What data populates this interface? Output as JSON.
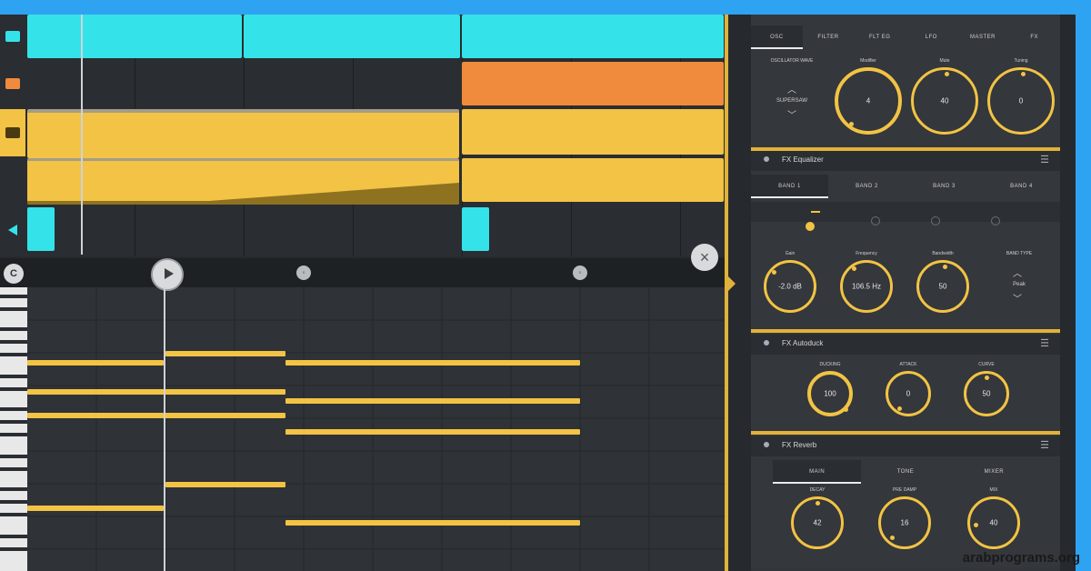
{
  "colors": {
    "accent": "#f2c344",
    "cyan": "#34e3ea",
    "orange": "#f08a3c",
    "background": "#26292d",
    "frame": "#2ea3f2"
  },
  "tracks": [
    {
      "icon": "synth-track-icon",
      "color": "#34e3ea"
    },
    {
      "icon": "bass-track-icon",
      "color": "#f08a3c"
    },
    {
      "icon": "keys-track-icon",
      "color": "#f2c344"
    },
    {
      "icon": "automation-track-icon",
      "color": "#f2c344"
    },
    {
      "icon": "drum-track-icon",
      "color": "#34e3ea"
    }
  ],
  "synth": {
    "tabs": [
      "OSC",
      "FILTER",
      "FLT EG",
      "LFO",
      "MASTER",
      "FX"
    ],
    "oscillator_label": "OSCILLATOR WAVE",
    "wave": "SUPERSAW",
    "knobs": [
      {
        "label": "Modifier",
        "value": "4"
      },
      {
        "label": "Mute",
        "value": "40"
      },
      {
        "label": "Tuning",
        "value": "0"
      }
    ]
  },
  "eq": {
    "title": "FX Equalizer",
    "tabs": [
      "BAND 1",
      "BAND 2",
      "BAND 3",
      "BAND 4"
    ],
    "knobs": [
      {
        "label": "Gain",
        "value": "-2.0 dB"
      },
      {
        "label": "Frequency",
        "value": "106.5 Hz"
      },
      {
        "label": "Bandwidth",
        "value": "50"
      }
    ],
    "band_type_label": "BAND TYPE",
    "band_type": "Peak"
  },
  "autoduck": {
    "title": "FX Autoduck",
    "knobs": [
      {
        "label": "DUCKING",
        "value": "100"
      },
      {
        "label": "ATTACK",
        "value": "0"
      },
      {
        "label": "CURVE",
        "value": "50"
      }
    ]
  },
  "reverb": {
    "title": "FX Reverb",
    "tabs": [
      "MAIN",
      "TONE",
      "MIXER"
    ],
    "knobs": [
      {
        "label": "DECAY",
        "value": "42"
      },
      {
        "label": "PRE DAMP",
        "value": "16"
      },
      {
        "label": "MIX",
        "value": "40"
      }
    ]
  },
  "watermark": "arabprograms.org"
}
